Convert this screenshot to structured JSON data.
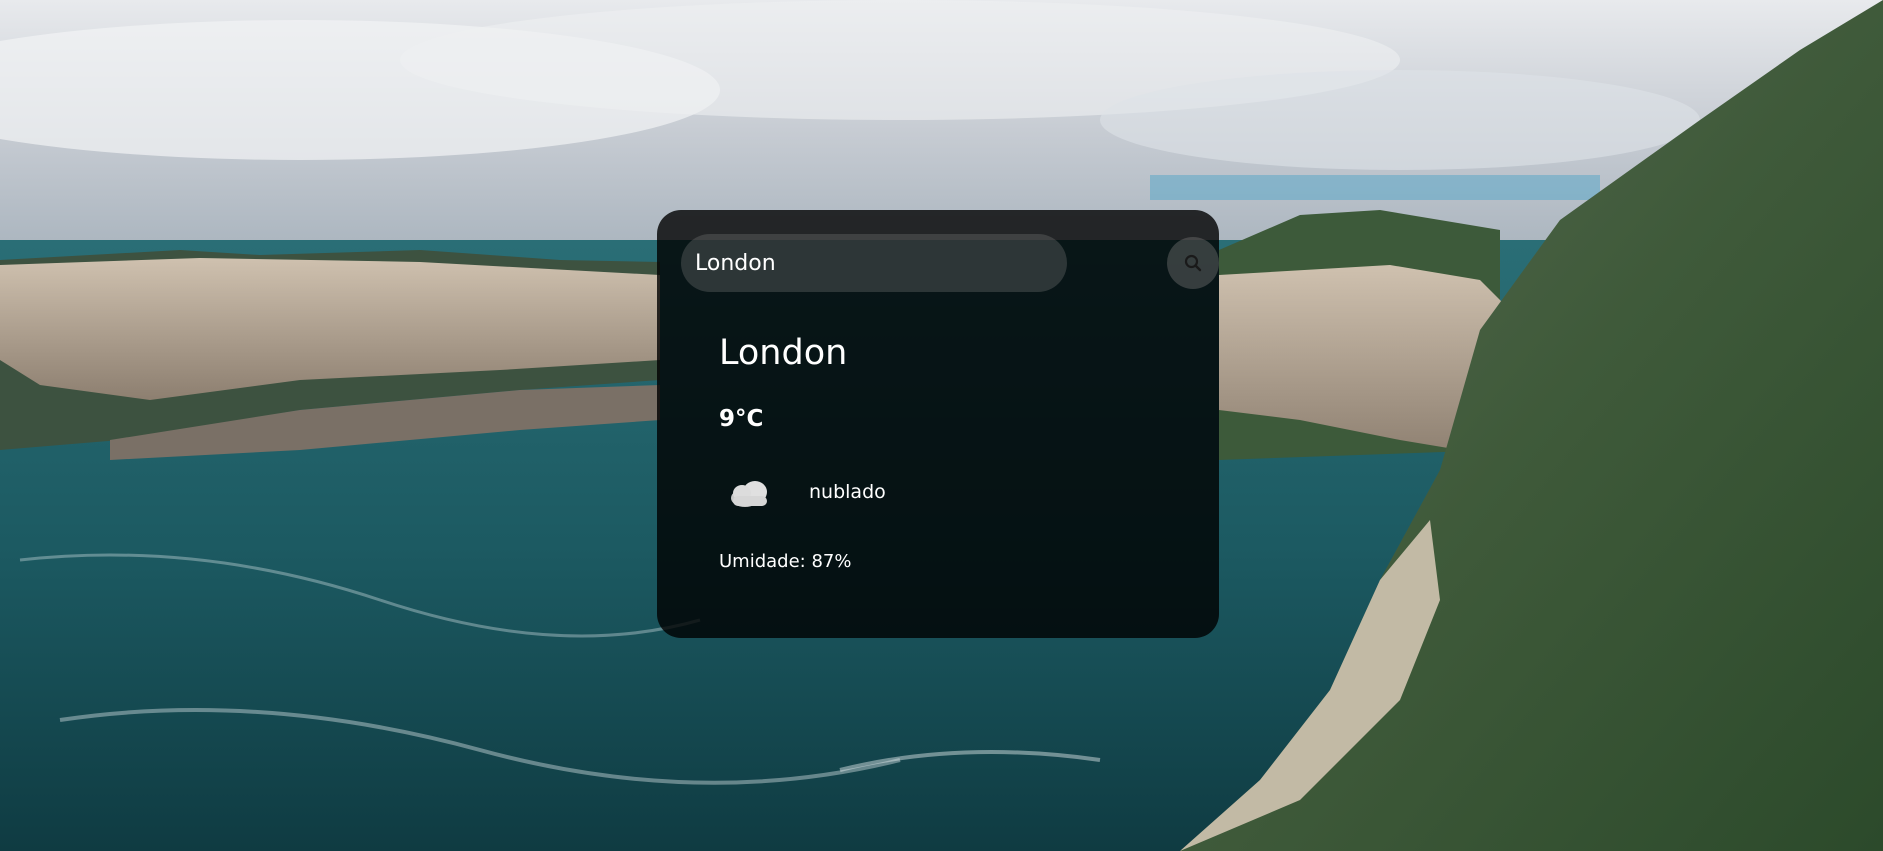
{
  "search": {
    "value": "London",
    "button_icon": "search-icon"
  },
  "weather": {
    "city": "London",
    "temperature": "9°C",
    "icon": "cloud-icon",
    "description": "nublado",
    "humidity": "Umidade: 87%"
  },
  "colors": {
    "card_background": "#000000cc",
    "text": "#ffffff",
    "input_background": "#7d7d7d52"
  }
}
